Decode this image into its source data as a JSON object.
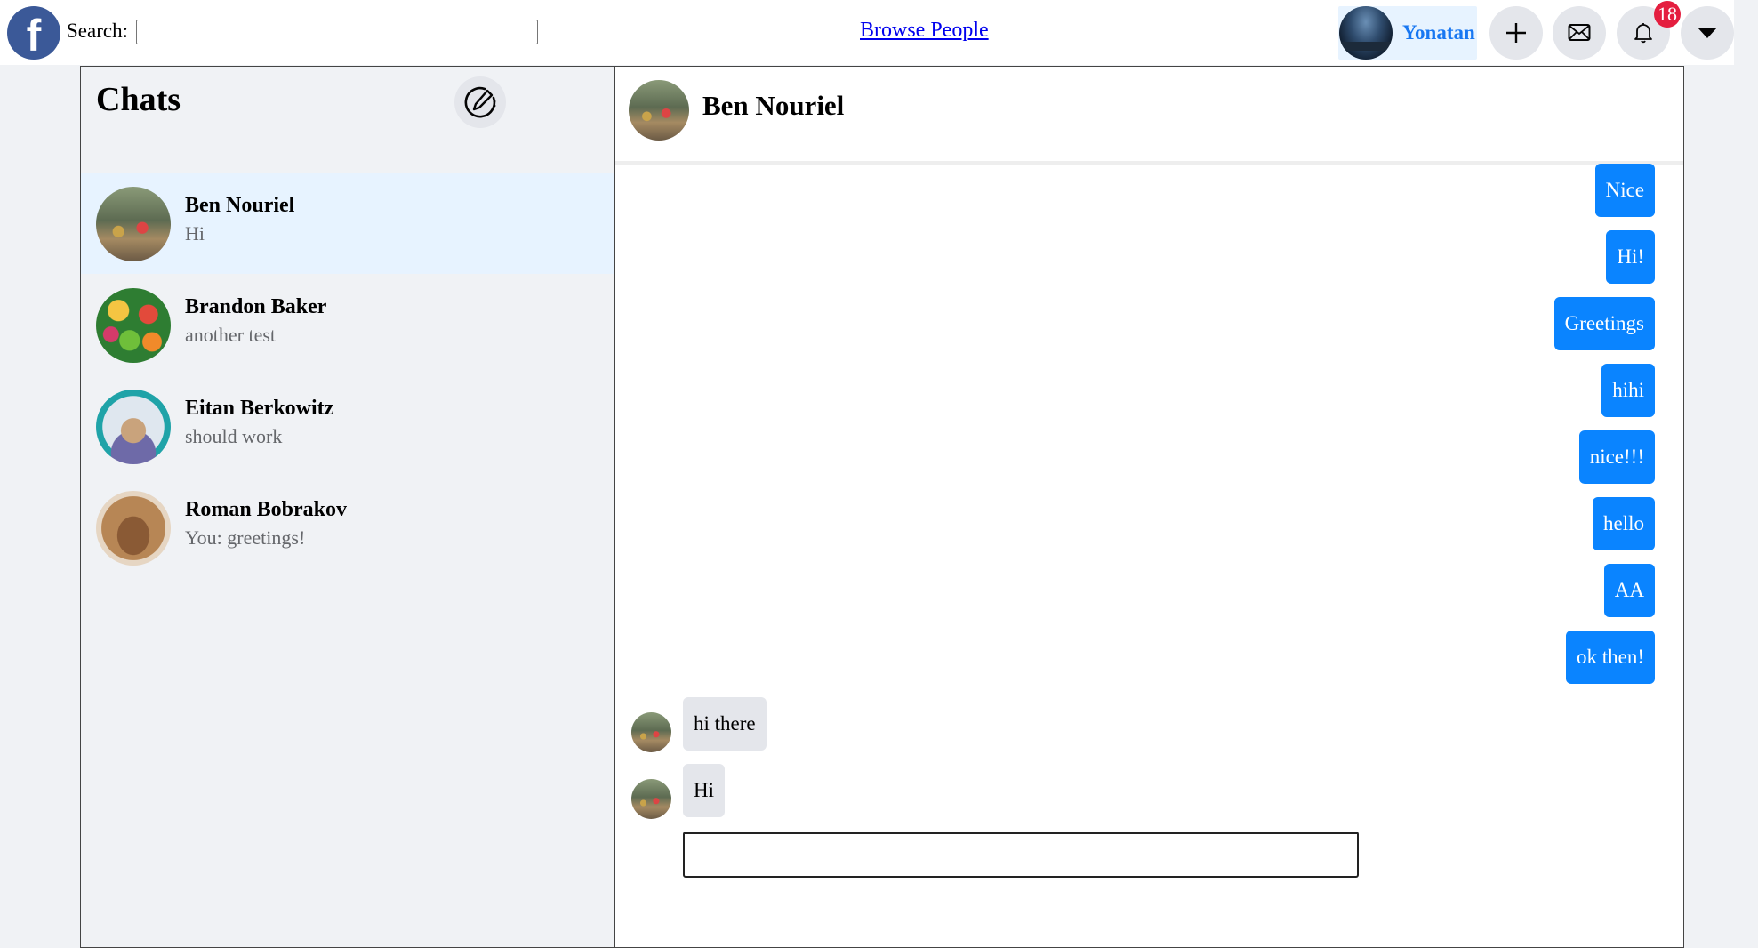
{
  "topbar": {
    "logo_letter": "f",
    "search_label": "Search:",
    "search_value": "",
    "browse_link": "Browse People",
    "user_name": "Yonatan",
    "notification_count": "18"
  },
  "sidebar": {
    "title": "Chats",
    "chats": [
      {
        "name": "Ben Nouriel",
        "preview": "Hi",
        "active": true
      },
      {
        "name": "Brandon Baker",
        "preview": "another test",
        "active": false
      },
      {
        "name": "Eitan Berkowitz",
        "preview": "should work",
        "active": false
      },
      {
        "name": "Roman Bobrakov",
        "preview": "You: greetings!",
        "active": false
      }
    ]
  },
  "conversation": {
    "contact_name": "Ben Nouriel",
    "messages": [
      {
        "text": "Nice",
        "direction": "outgoing"
      },
      {
        "text": "Hi!",
        "direction": "outgoing"
      },
      {
        "text": "Greetings",
        "direction": "outgoing"
      },
      {
        "text": "hihi",
        "direction": "outgoing"
      },
      {
        "text": "nice!!!",
        "direction": "outgoing"
      },
      {
        "text": "hello",
        "direction": "outgoing"
      },
      {
        "text": "AA",
        "direction": "outgoing"
      },
      {
        "text": "ok then!",
        "direction": "outgoing"
      },
      {
        "text": "hi there",
        "direction": "incoming"
      },
      {
        "text": "Hi",
        "direction": "incoming"
      }
    ],
    "reply_value": ""
  },
  "colors": {
    "accent": "#1877f2",
    "outgoing_bubble": "#0a84ff",
    "incoming_bubble": "#e4e6eb",
    "badge": "#e41e3f",
    "active_chat": "#e7f3ff",
    "page_background": "#f0f2f5"
  },
  "icons": {
    "logo": "facebook-logo-icon",
    "create": "plus-icon",
    "messages": "envelope-icon",
    "notifications": "bell-icon",
    "menu": "caret-down-icon",
    "compose": "edit-pen-icon"
  }
}
